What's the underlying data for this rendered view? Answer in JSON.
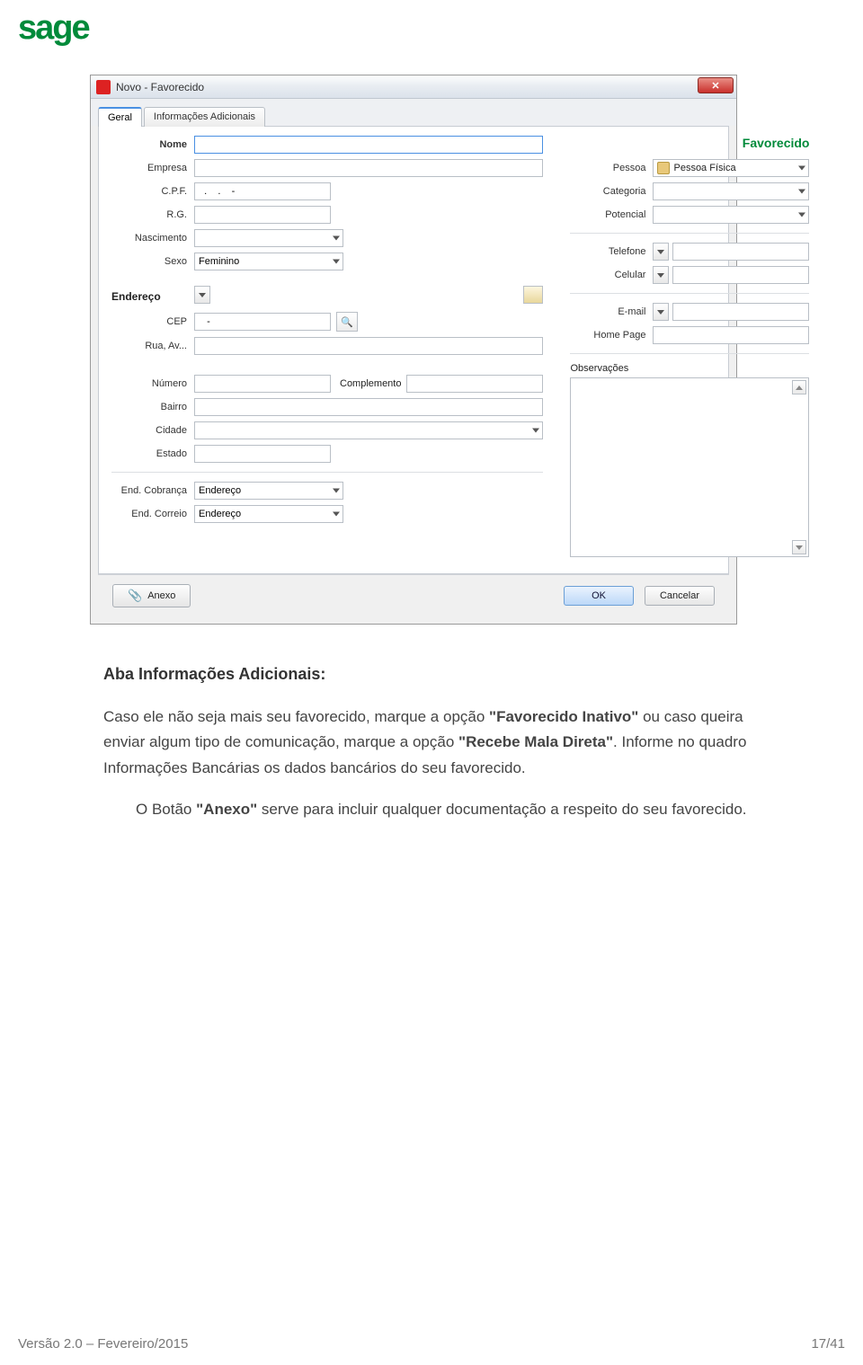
{
  "logo": "sage",
  "window": {
    "title": "Novo - Favorecido",
    "close": "✕",
    "tabs": {
      "geral": "Geral",
      "info": "Informações Adicionais"
    },
    "right_head": "Favorecido",
    "left": {
      "nome": "Nome",
      "empresa": "Empresa",
      "cpf_lbl": "C.P.F.",
      "cpf_val": "  .    .    -  ",
      "rg": "R.G.",
      "nascimento": "Nascimento",
      "sexo_lbl": "Sexo",
      "sexo_val": "Feminino",
      "endereco": "Endereço",
      "cep_lbl": "CEP",
      "cep_val": "   -",
      "rua": "Rua, Av...",
      "numero": "Número",
      "complemento": "Complemento",
      "bairro": "Bairro",
      "cidade": "Cidade",
      "estado": "Estado",
      "end_cobranca_lbl": "End. Cobrança",
      "end_cobranca_val": "Endereço",
      "end_correio_lbl": "End. Correio",
      "end_correio_val": "Endereço"
    },
    "right": {
      "pessoa_lbl": "Pessoa",
      "pessoa_val": "Pessoa Física",
      "categoria": "Categoria",
      "potencial": "Potencial",
      "telefone": "Telefone",
      "celular": "Celular",
      "email": "E-mail",
      "homepage": "Home Page",
      "observacoes": "Observações"
    },
    "buttons": {
      "anexo": "Anexo",
      "ok": "OK",
      "cancelar": "Cancelar"
    }
  },
  "doc": {
    "heading": "Aba Informações Adicionais:",
    "p1_a": "Caso ele não seja mais seu favorecido, marque a opção ",
    "p1_b": "\"Favorecido Inativo\"",
    "p1_c": " ou caso queira enviar algum tipo de comunicação, marque a opção ",
    "p1_d": "\"Recebe Mala Direta\"",
    "p1_e": ". Informe no quadro Informações Bancárias os dados bancários do seu favorecido.",
    "p2_a": "O Botão ",
    "p2_b": "\"Anexo\"",
    "p2_c": " serve para incluir qualquer documentação a respeito do seu favorecido."
  },
  "footer": {
    "left": "Versão 2.0 – Fevereiro/2015",
    "right": "17/41"
  }
}
